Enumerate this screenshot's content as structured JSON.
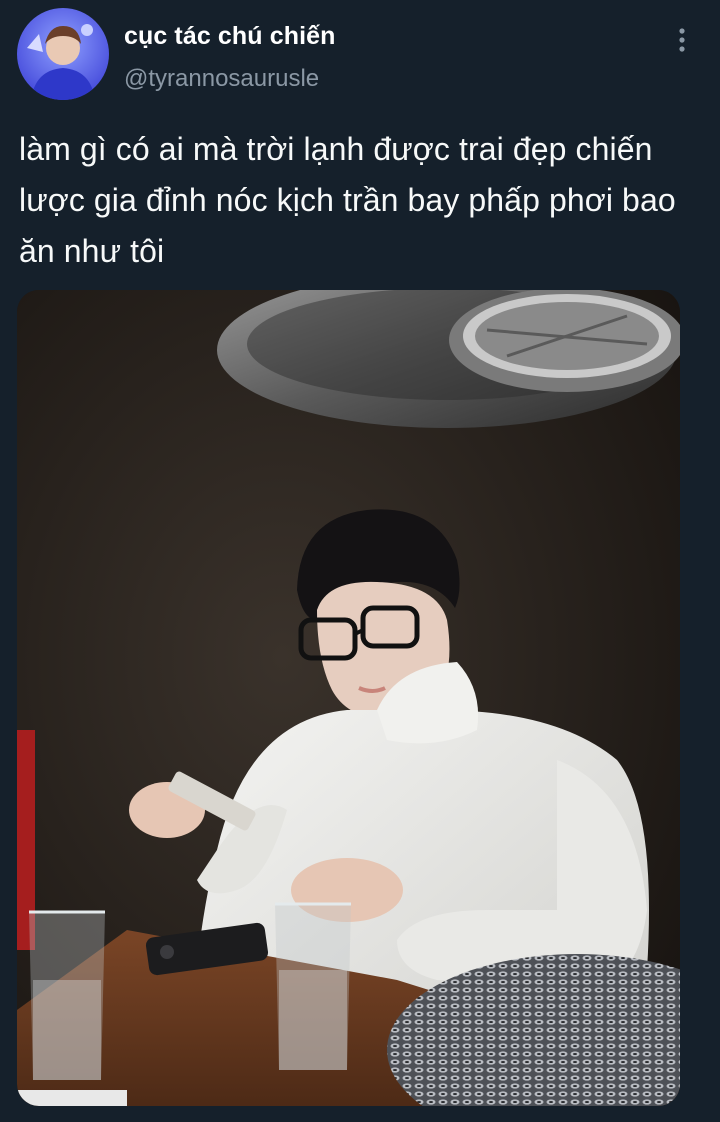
{
  "tweet": {
    "author": {
      "display_name": "cục tác chú chiến",
      "handle": "@tyrannosaurusle"
    },
    "text_lines": [
      "làm gì có ai mà trời lạnh được trai đẹp chiến",
      "lược gia đỉnh nóc kịch trần bay phấp phơi bao",
      "ăn như tôi"
    ],
    "icons": {
      "more": "more-vertical-icon"
    },
    "media": {
      "type": "photo"
    }
  },
  "colors": {
    "background": "#15202b",
    "text_primary": "#ffffff",
    "text_secondary": "#8b98a5"
  }
}
